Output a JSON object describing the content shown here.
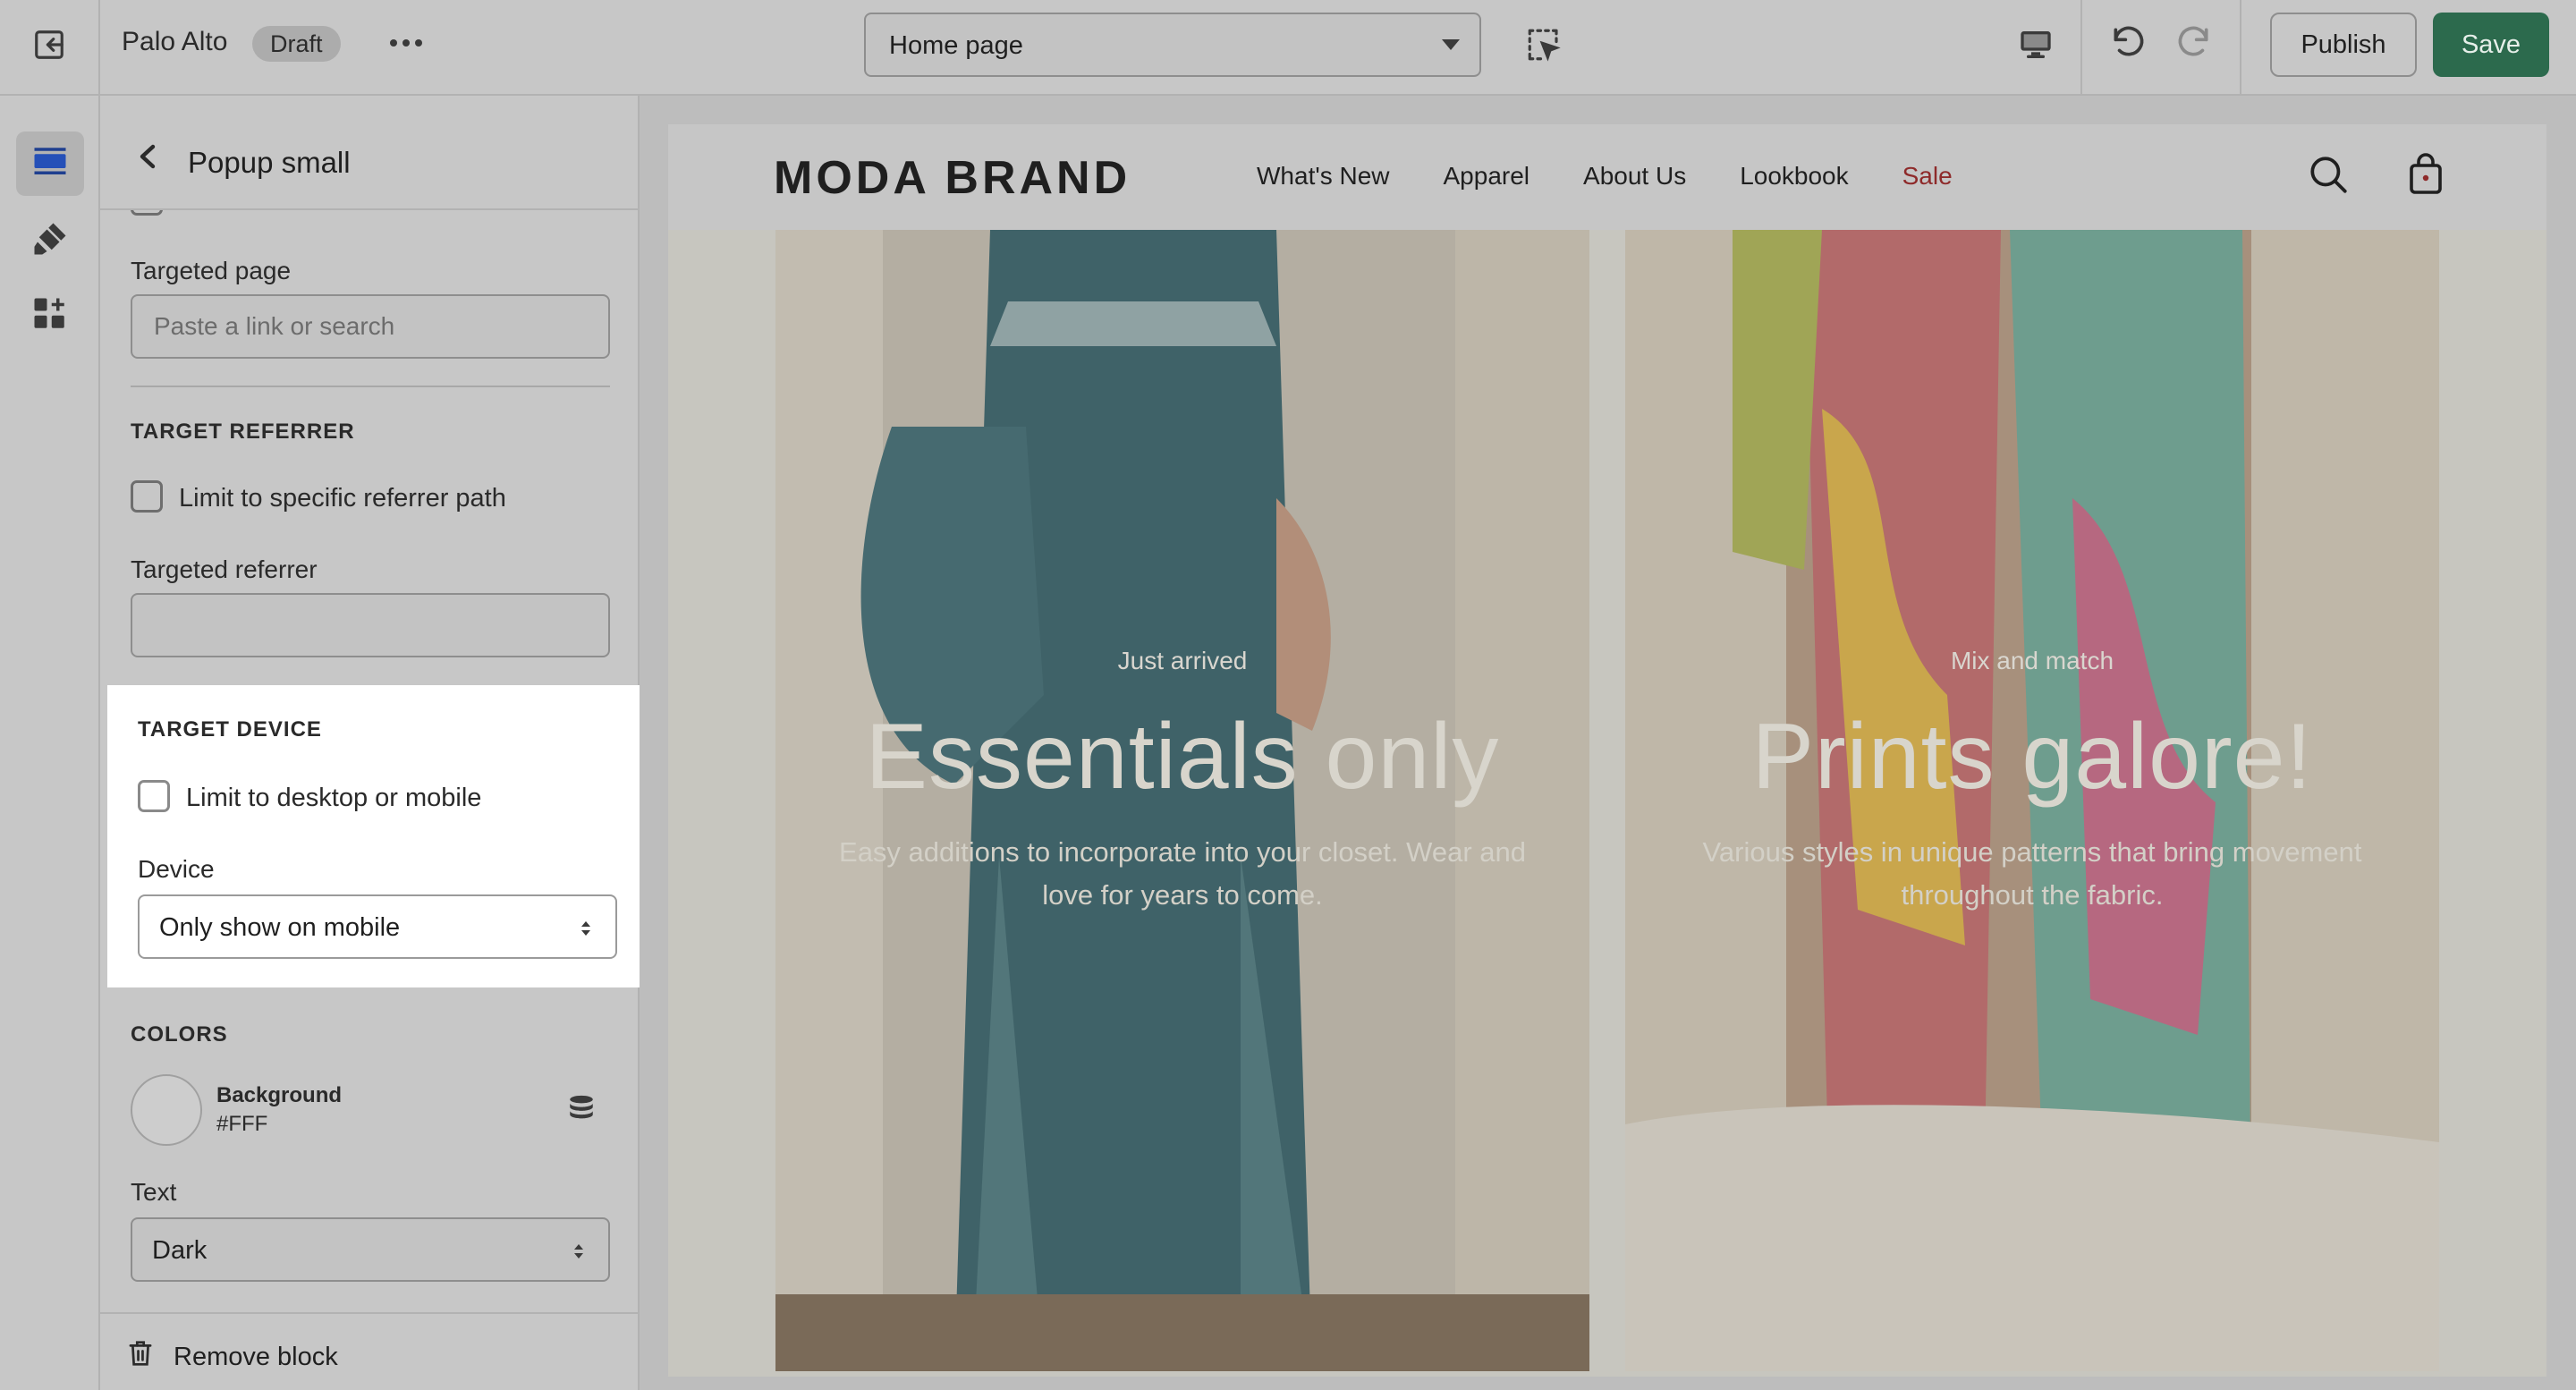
{
  "topbar": {
    "store_name": "Palo Alto",
    "status_badge": "Draft",
    "page_select_value": "Home page",
    "publish_label": "Publish",
    "save_label": "Save"
  },
  "panel": {
    "title": "Popup small",
    "targeted_page_label": "Targeted page",
    "targeted_page_placeholder": "Paste a link or search",
    "target_referrer_heading": "TARGET REFERRER",
    "referrer_checkbox_label": "Limit to specific referrer path",
    "targeted_referrer_label": "Targeted referrer",
    "targeted_referrer_value": "",
    "target_device_heading": "TARGET DEVICE",
    "device_checkbox_label": "Limit to desktop or mobile",
    "device_label": "Device",
    "device_value": "Only show on mobile",
    "colors_heading": "COLORS",
    "background_label": "Background",
    "background_value": "#FFF",
    "text_label": "Text",
    "text_value": "Dark",
    "remove_label": "Remove block"
  },
  "site": {
    "brand": "MODA BRAND",
    "nav": [
      "What's New",
      "Apparel",
      "About Us",
      "Lookbook",
      "Sale"
    ],
    "cards": [
      {
        "pre": "Just arrived",
        "title": "Essentials only",
        "sub": "Easy additions to incorporate into your closet. Wear and love for years to come."
      },
      {
        "pre": "Mix and match",
        "title": "Prints galore!",
        "sub": "Various styles in unique patterns that bring movement throughout the fabric."
      }
    ]
  },
  "colors": {
    "save_green": "#2c6a4d",
    "sale_red": "#8e2a2a",
    "overlay_gray": "#c7c7c7",
    "highlight_white": "#ffffff"
  },
  "icons": {
    "exit": "exit-icon",
    "more": "more-horizontal-icon",
    "inspector": "select-inspector-icon",
    "device": "desktop-icon",
    "undo": "undo-icon",
    "redo": "redo-icon",
    "sections": "sections-icon",
    "theme": "paintbrush-icon",
    "apps": "apps-icon",
    "back": "chevron-left-icon",
    "database": "database-icon",
    "trash": "trash-icon",
    "search": "search-icon",
    "cart": "shopping-bag-icon"
  }
}
